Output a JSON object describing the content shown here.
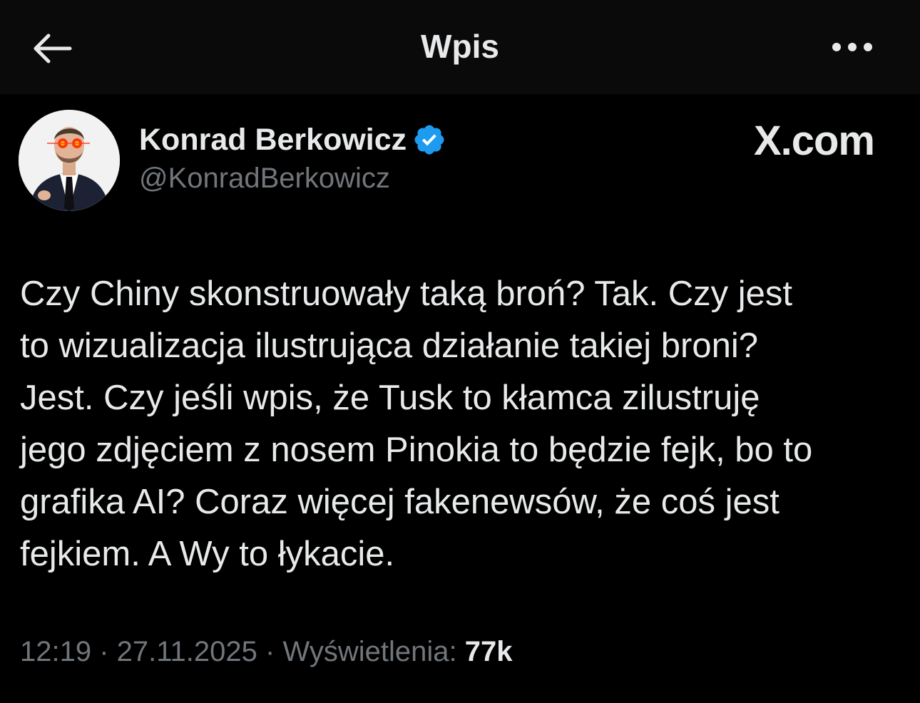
{
  "header": {
    "title": "Wpis",
    "back_icon": "arrow-left-icon",
    "more_icon": "more-horizontal-icon"
  },
  "author": {
    "name": "Konrad Berkowicz",
    "handle": "@KonradBerkowicz",
    "verified": true,
    "verified_color": "#1d9bf0",
    "avatar_icon": "profile-photo"
  },
  "watermark": "X.com",
  "tweet": {
    "lines": [
      "Czy Chiny skonstruowały taką broń? Tak. Czy jest",
      "to wizualizacja ilustrująca działanie takiej broni?",
      "Jest. Czy jeśli wpis, że Tusk to kłamca zilustruję",
      "jego zdjęciem z nosem Pinokia to będzie fejk, bo to",
      "grafika AI? Coraz więcej fakenewsów, że coś jest",
      "fejkiem. A Wy to łykacie."
    ]
  },
  "meta": {
    "time": "12:19",
    "separator": " · ",
    "date": "27.11.2025",
    "views_label": "Wyświetlenia: ",
    "views_count": "77k"
  },
  "colors": {
    "background": "#000000",
    "header_bg": "#0a0a0a",
    "text": "#e7e9ea",
    "secondary_text": "#71767b"
  }
}
